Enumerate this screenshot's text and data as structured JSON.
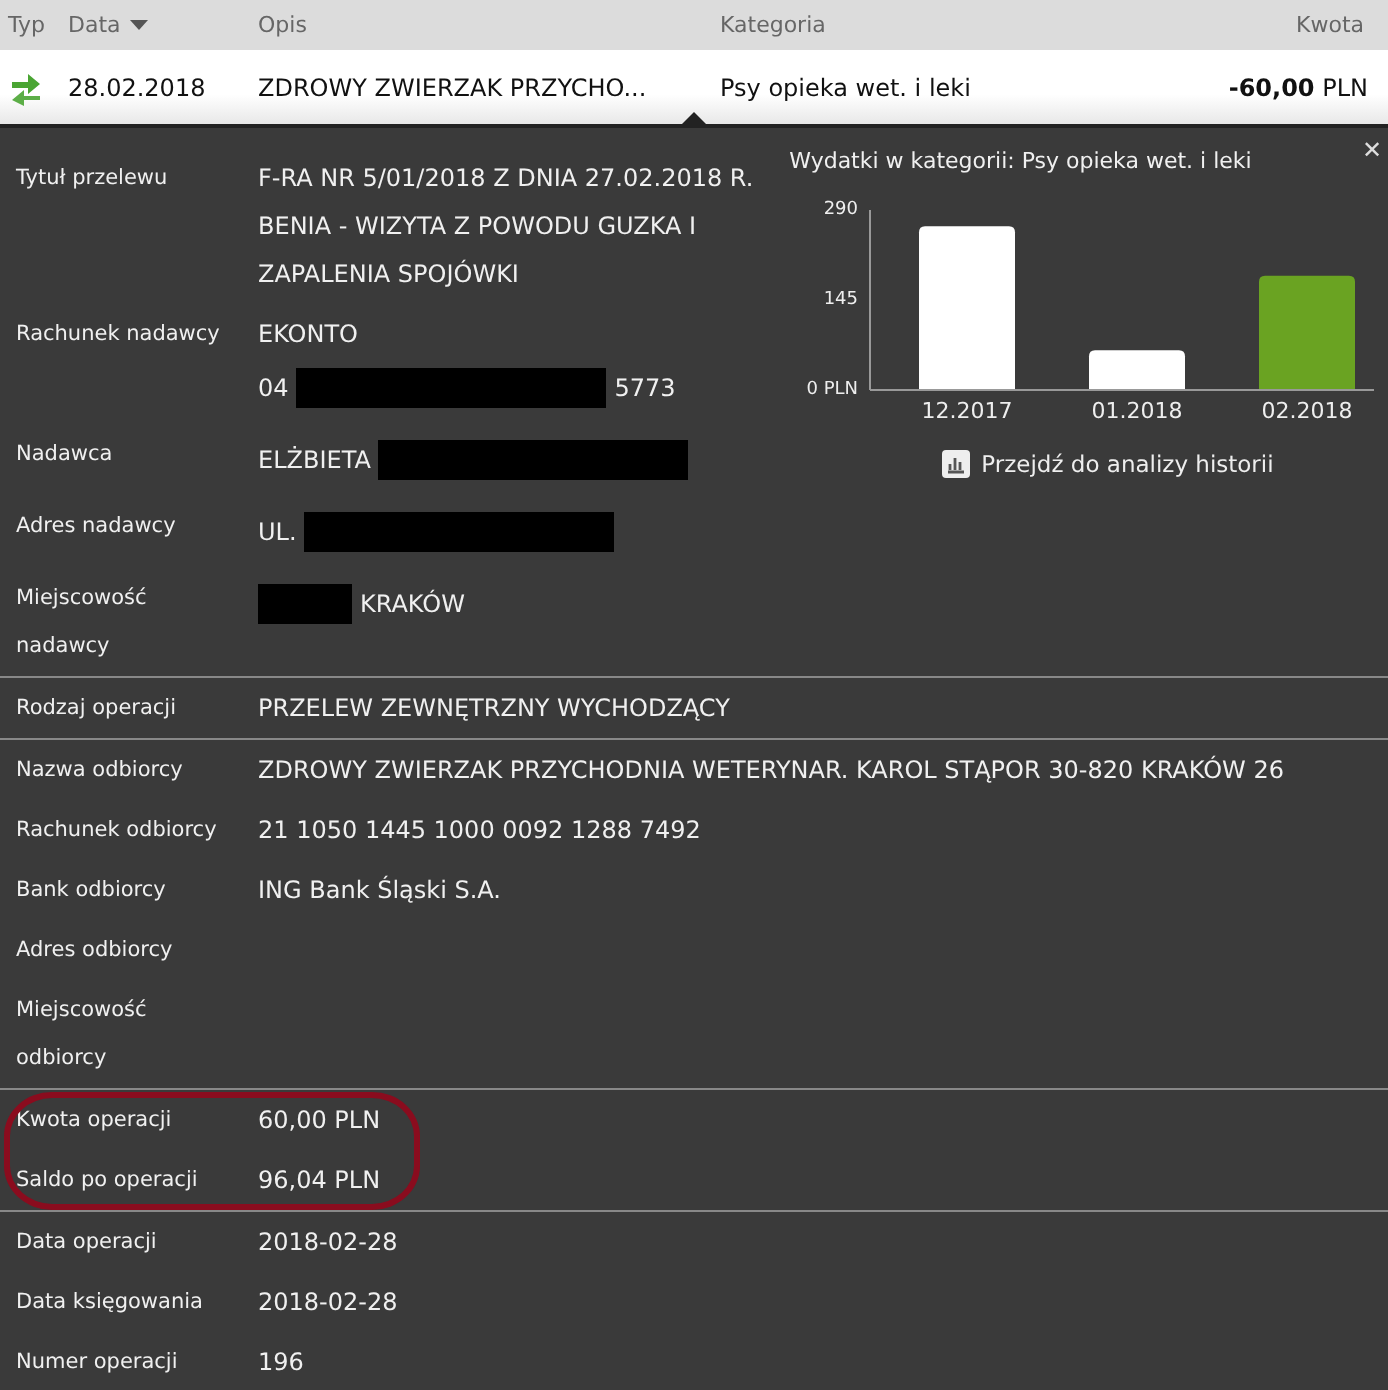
{
  "table": {
    "columns": [
      {
        "label": "Typ",
        "sorted": false
      },
      {
        "label": "Data",
        "sorted": true
      },
      {
        "label": "Opis",
        "sorted": false
      },
      {
        "label": "Kategoria",
        "sorted": false
      },
      {
        "label": "Kwota",
        "sorted": false
      }
    ],
    "close_label": "✕",
    "row": {
      "date": "28.02.2018",
      "description": "ZDROWY ZWIERZAK PRZYCHO...",
      "category": "Psy opieka wet. i leki",
      "amount": "-60,00",
      "currency": "PLN",
      "expanded": true
    }
  },
  "details": {
    "sections": [
      {
        "highlighted": false,
        "rows": [
          {
            "label": "Tytuł przelewu",
            "lines": [
              [
                {
                  "kind": "text",
                  "text": "F-RA NR 5/01/2018 Z DNIA 27.02.2018 R."
                }
              ],
              [
                {
                  "kind": "text",
                  "text": "BENIA - WIZYTA Z POWODU GUZKA I"
                }
              ],
              [
                {
                  "kind": "text",
                  "text": "ZAPALENIA SPOJÓWKI"
                }
              ]
            ]
          },
          {
            "label": "Rachunek nadawcy",
            "lines": [
              [
                {
                  "kind": "text",
                  "text": "EKONTO"
                }
              ],
              [
                {
                  "kind": "text",
                  "text": "04"
                },
                {
                  "kind": "redacted"
                },
                {
                  "kind": "text",
                  "text": "5773"
                }
              ]
            ]
          },
          {
            "label": "Nadawca",
            "lines": [
              [
                {
                  "kind": "text",
                  "text": "ELŻBIETA"
                },
                {
                  "kind": "redacted"
                }
              ]
            ]
          },
          {
            "label": "Adres nadawcy",
            "lines": [
              [
                {
                  "kind": "text",
                  "text": "UL."
                },
                {
                  "kind": "redacted"
                }
              ]
            ]
          },
          {
            "label": "Miejscowość nadawcy",
            "lines": [
              [
                {
                  "kind": "redacted"
                },
                {
                  "kind": "text",
                  "text": "KRAKÓW"
                }
              ]
            ]
          }
        ],
        "chart": {
          "title": "Wydatki w kategorii:  Psy opieka wet. i leki",
          "link": "Przejdź do analizy historii",
          "chart_data": {
            "type": "bar",
            "categories": [
              "12.2017",
              "01.2018",
              "02.2018"
            ],
            "series": [
              {
                "color": "#ffffff",
                "values": [
                  264,
                  64,
                  null
                ]
              },
              {
                "color": "#6aa322",
                "values": [
                  null,
                  null,
                  184
                ]
              }
            ],
            "ylim": [
              0,
              290
            ],
            "yticks": [
              {
                "value": 0,
                "label": "0 PLN"
              },
              145,
              290
            ]
          }
        }
      },
      {
        "highlighted": false,
        "rows": [
          {
            "label": "Rodzaj operacji",
            "lines": [
              [
                {
                  "kind": "text",
                  "text": "PRZELEW ZEWNĘTRZNY WYCHODZĄCY"
                }
              ]
            ]
          }
        ]
      },
      {
        "highlighted": false,
        "rows": [
          {
            "label": "Nazwa odbiorcy",
            "lines": [
              [
                {
                  "kind": "text",
                  "text": "ZDROWY ZWIERZAK PRZYCHODNIA WETERYNAR. KAROL STĄPOR 30-820 KRAKÓW 26"
                }
              ]
            ]
          },
          {
            "label": "Rachunek odbiorcy",
            "lines": [
              [
                {
                  "kind": "text",
                  "text": "21 1050 1445 1000 0092 1288 7492"
                }
              ]
            ]
          },
          {
            "label": "Bank odbiorcy",
            "lines": [
              [
                {
                  "kind": "text",
                  "text": "ING Bank Śląski S.A."
                }
              ]
            ]
          },
          {
            "label": "Adres odbiorcy",
            "lines": []
          },
          {
            "label": "Miejscowość odbiorcy",
            "lines": []
          }
        ]
      },
      {
        "highlighted": true,
        "rows": [
          {
            "label": "Kwota operacji",
            "lines": [
              [
                {
                  "kind": "text",
                  "text": "60,00 PLN"
                }
              ]
            ]
          },
          {
            "label": "Saldo po operacji",
            "lines": [
              [
                {
                  "kind": "text",
                  "text": "96,04 PLN"
                }
              ]
            ]
          }
        ]
      },
      {
        "highlighted": false,
        "rows": [
          {
            "label": "Data operacji",
            "lines": [
              [
                {
                  "kind": "text",
                  "text": "2018-02-28"
                }
              ]
            ]
          },
          {
            "label": "Data księgowania",
            "lines": [
              [
                {
                  "kind": "text",
                  "text": "2018-02-28"
                }
              ]
            ]
          },
          {
            "label": "Numer operacji",
            "lines": [
              [
                {
                  "kind": "text",
                  "text": "196"
                }
              ]
            ]
          }
        ]
      }
    ]
  }
}
